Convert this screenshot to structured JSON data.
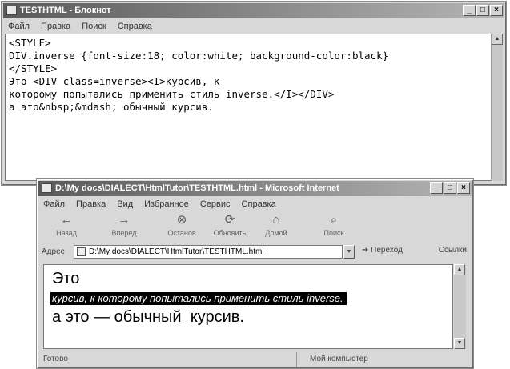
{
  "notepad": {
    "title": "TESTHTML - Блокнот",
    "menu": [
      "Файл",
      "Правка",
      "Поиск",
      "Справка"
    ],
    "lines": [
      "<STYLE>",
      "DIV.inverse {font-size:18; color:white; background-color:black}",
      "</STYLE>",
      "",
      "Это <DIV class=inverse><I>курсив, к",
      "которому попытались применить стиль inverse.</I></DIV>",
      "а это&nbsp;&mdash; обычный курсив."
    ]
  },
  "browser": {
    "title": "D:\\My docs\\DIALECT\\HtmlTutor\\TESTHTML.html - Microsoft Internet",
    "menu": [
      "Файл",
      "Правка",
      "Вид",
      "Избранное",
      "Сервис",
      "Справка"
    ],
    "toolbar": [
      {
        "label": "Назад",
        "icon": "←"
      },
      {
        "label": "Вперед",
        "icon": "→"
      },
      {
        "label": "Останов",
        "icon": "⊗"
      },
      {
        "label": "Обновить",
        "icon": "⟳"
      },
      {
        "label": "Домой",
        "icon": "⌂"
      },
      {
        "label": "Поиск",
        "icon": "⌕"
      }
    ],
    "address_label": "Адрес",
    "address": "D:\\My docs\\DIALECT\\HtmlTutor\\TESTHTML.html",
    "go_label": "Переход",
    "links_label": "Ссылки",
    "content": {
      "line1": "Это",
      "line2": "курсив, к которому попытались применить стиль inverse.",
      "line3": "а это — обычный  курсив."
    },
    "status": {
      "ready": "Готово",
      "zone": "Мой компьютер"
    }
  }
}
